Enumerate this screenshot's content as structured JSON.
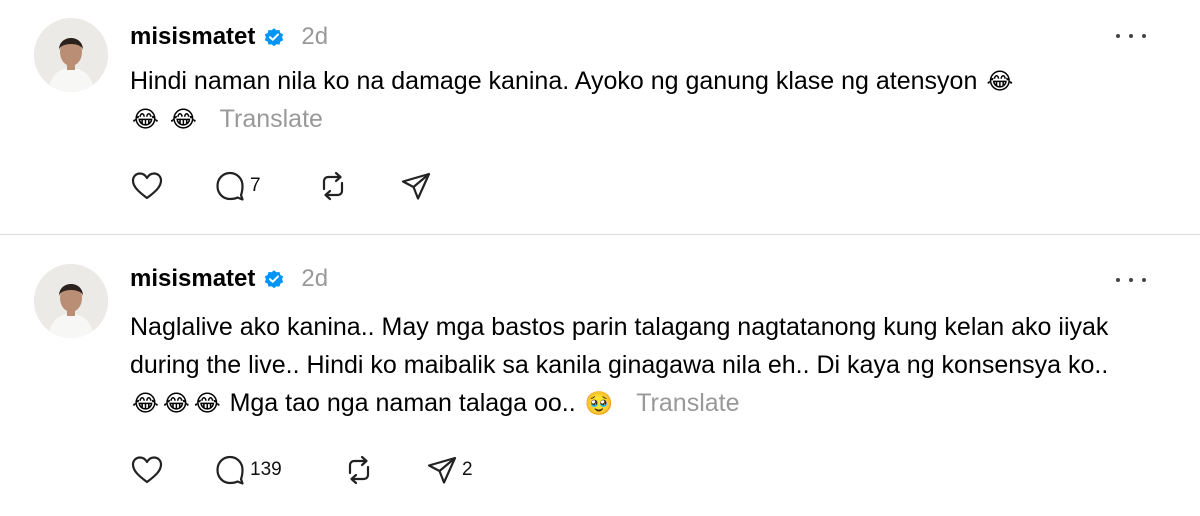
{
  "posts": [
    {
      "username": "misismatet",
      "time": "2d",
      "text_before": "Hindi naman nila ko na damage kanina. Ayoko ng ganung klase ng atensyon",
      "emojis": [
        "😂",
        "😂",
        "😂"
      ],
      "translate_label": "Translate",
      "replies": "7",
      "shares": ""
    },
    {
      "username": "misismatet",
      "time": "2d",
      "text_before": "Naglalive ako kanina.. May mga bastos parin talagang nagtatanong kung kelan ako iiyak during the live.. Hindi ko maibalik sa kanila ginagawa nila eh.. Di kaya ng konsensya ko..",
      "emojis": [
        "😂",
        "😂",
        "😂"
      ],
      "text_after": "Mga tao nga naman talaga oo..",
      "emoji_end": "🥹",
      "translate_label": "Translate",
      "replies": "139",
      "shares": "2"
    }
  ],
  "colors": {
    "verified": "#0095f6",
    "muted": "#999999",
    "divider": "#dbdbdb"
  },
  "icons": [
    "heart-icon",
    "comment-icon",
    "repost-icon",
    "share-icon",
    "more-icon",
    "verified-icon"
  ]
}
